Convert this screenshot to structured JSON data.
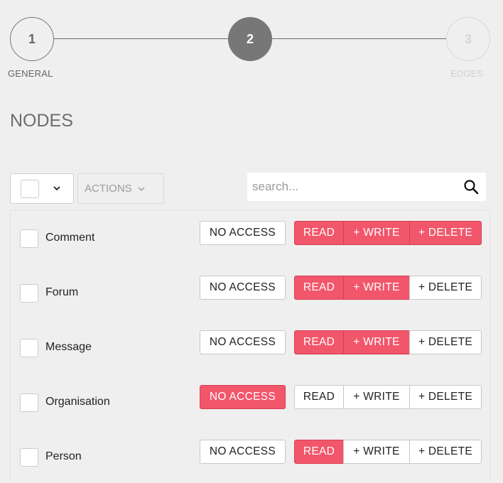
{
  "stepper": {
    "steps": [
      {
        "number": "1",
        "label": "GENERAL"
      },
      {
        "number": "2",
        "label": ""
      },
      {
        "number": "3",
        "label": "EDGES"
      }
    ]
  },
  "page_title": "NODES",
  "toolbar": {
    "actions_label": "ACTIONS",
    "search_placeholder": "search..."
  },
  "permission_labels": {
    "no_access": "NO ACCESS",
    "read": "READ",
    "write": "+ WRITE",
    "delete": "+ DELETE"
  },
  "colors": {
    "active": "#f1566b",
    "background": "#efefef"
  },
  "nodes": [
    {
      "name": "Comment",
      "permission": "delete"
    },
    {
      "name": "Forum",
      "permission": "write"
    },
    {
      "name": "Message",
      "permission": "write"
    },
    {
      "name": "Organisation",
      "permission": "no_access"
    },
    {
      "name": "Person",
      "permission": "read"
    }
  ]
}
